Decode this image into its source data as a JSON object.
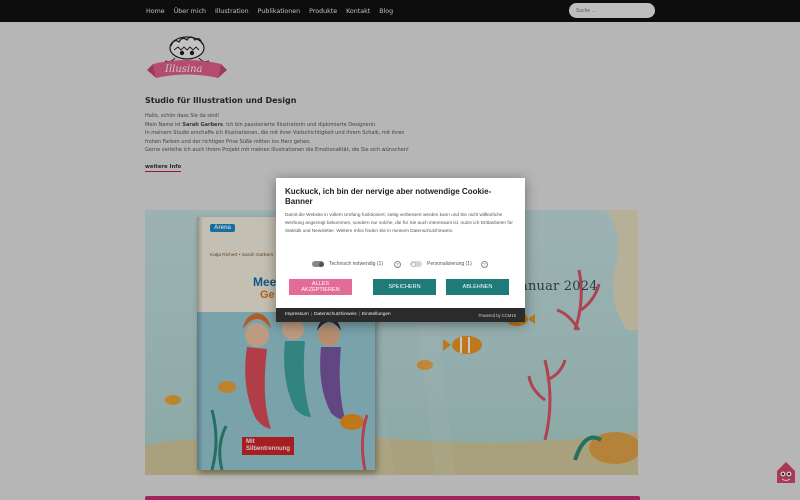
{
  "nav": {
    "items": [
      "Home",
      "Über mich",
      "Illustration",
      "Publikationen",
      "Produkte",
      "Kontakt",
      "Blog"
    ],
    "search_placeholder": "Suche ..."
  },
  "logo": {
    "text": "Illusina"
  },
  "intro": {
    "headline": "Studio für Illustration und Design",
    "greeting": "Hallo, schön dass Sie da sind!",
    "name_prefix": "Mein Name ist ",
    "name": "Sarah Garbers",
    "name_suffix": ". Ich bin passionierte Illustratorin und diplomierte Designerin.",
    "line3": "In meinem Studio erschaffe ich Illustrationen, die mit ihrer Vielschichtigkeit und ihrem Schalk, mit ihren",
    "line4": "frohen Farben und der richtigen Prise Süße mitten ins Herz gehen.",
    "line5": "Gerne verleihe ich auch Ihrem Projekt mit meinen Illustrationen die Emotionalität, die Sie sich wünschen!",
    "more_link": "weitere Info"
  },
  "banner": {
    "date_text": "anuar 2024",
    "book": {
      "publisher": "Arena",
      "authors": "Katja Richert • Sarah Garbers",
      "title_line1": "Meer",
      "title_line2": "Ge",
      "syllable_badge_line1": "Mit",
      "syllable_badge_line2": "Silbentrennung"
    }
  },
  "cookie": {
    "title": "Kuckuck, ich bin der nervige aber notwendige Cookie-Banner",
    "text": "Damit die Website in vollem Umfang funktioniert, stetig verbessert werden kann und Sie nicht willkürliche Werbung angezeigt bekommen, sondern nur solche, die für Sie auch interessant ist, nutze ich Drittanbieter für Statistik und Newsletter. Weitere Infos finden Sie in meinem Datenschutzhinweis.",
    "toggle_necessary": "Technisch notwendig (1)",
    "toggle_personal": "Personalisierung (1)",
    "info_glyph": "?",
    "accept_line1": "ALLES",
    "accept_line2": "AKZEPTIEREN",
    "save": "SPEICHERN",
    "decline": "ABLEHNEN",
    "footer_links": [
      "Impressum",
      "Datenschutzhinweis",
      "Einstellungen"
    ],
    "powered_by": "Powered by CCM19"
  },
  "colors": {
    "accent_pink": "#e36b98",
    "teal": "#1f7a7a",
    "nav_bg": "#111111"
  }
}
